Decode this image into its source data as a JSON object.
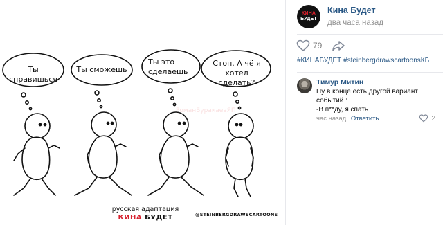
{
  "comic": {
    "bubbles": [
      "Ты справишься",
      "Ты сможешь",
      "Ты это сделаешь",
      "Стоп. А чё я хотел сделать?"
    ],
    "caption_line1": "русская адаптация",
    "caption_brand_red": "КИНА",
    "caption_brand_black": "БУДЕТ",
    "handle": "@STEINBERGDRAWSCARTOONS",
    "watermark": "РоманБуракаевЯП"
  },
  "post": {
    "author": "Кина Будет",
    "avatar_line1": "КИНА",
    "avatar_line2": "БУДЕТ",
    "time": "два часа назад",
    "likes": "79",
    "hashtags": "#КИНАБУДЕТ #steinbergdrawscartoonsКБ"
  },
  "comment": {
    "author": "Тимур Митин",
    "text_line1": "Ну в конце есть другой вариант событий :",
    "text_line2": "-В п**ду, я спать",
    "time": "час назад",
    "reply": "Ответить",
    "likes": "2"
  },
  "colors": {
    "link": "#2a5885",
    "muted": "#939393",
    "brand_red": "#d6202e"
  },
  "icons": [
    "heart-icon",
    "share-icon",
    "comment-heart-icon"
  ]
}
